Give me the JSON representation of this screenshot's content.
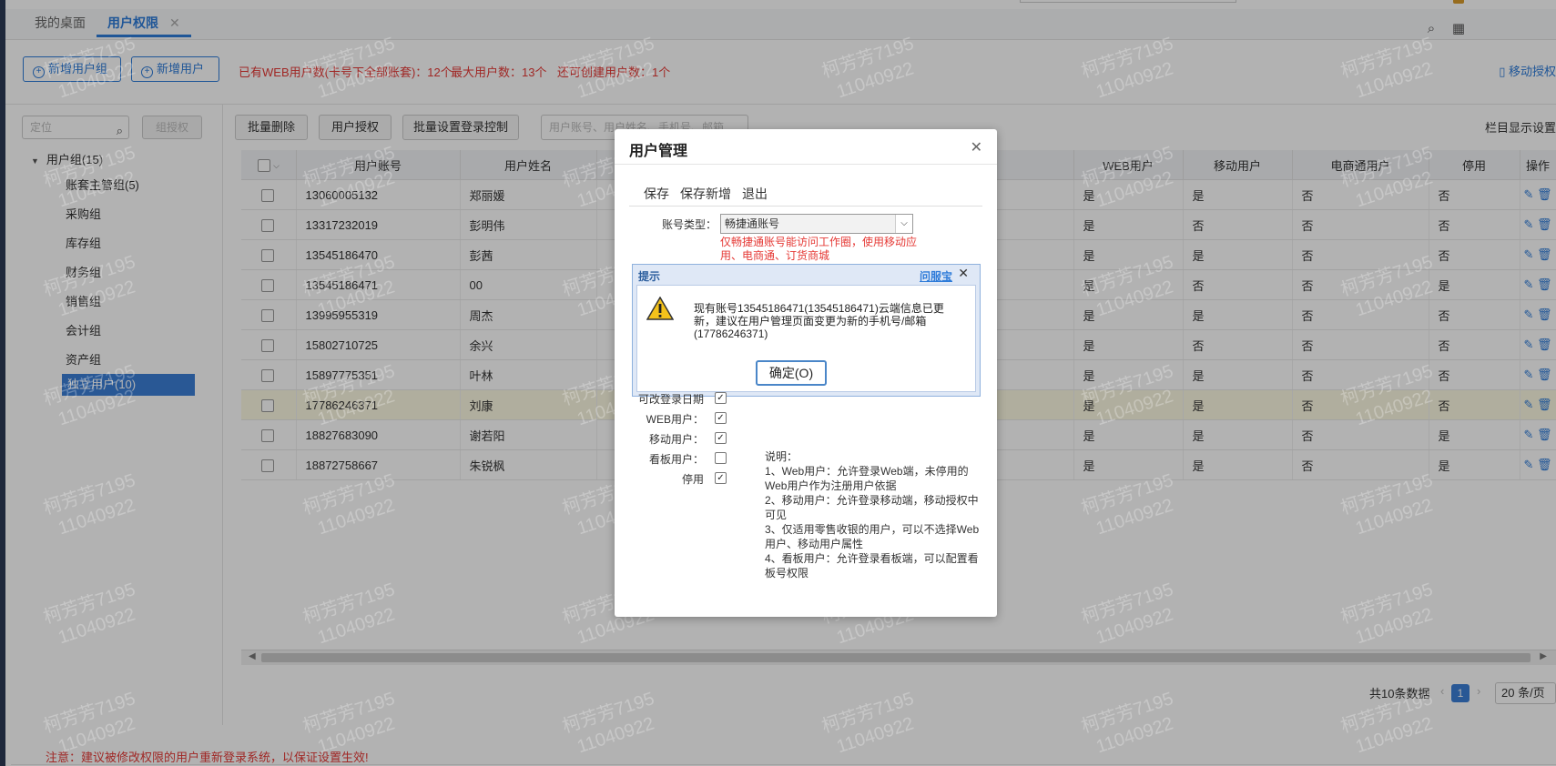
{
  "tabs": [
    {
      "label": "我的桌面"
    },
    {
      "label": "用户权限"
    }
  ],
  "toolbar": {
    "add_group": "新增用户组",
    "add_user": "新增用户",
    "web_user_count": "已有WEB用户数(卡号下全部账套)：12个",
    "max_users": "最大用户数：13个",
    "can_create": "还可创建用户数：1个",
    "mobile_auth": "移动授权"
  },
  "sidebar": {
    "locate_placeholder": "定位",
    "group_auth": "组授权",
    "root": "用户组(15)",
    "items": [
      "账套主管组(5)",
      "采购组",
      "库存组",
      "财务组",
      "销售组",
      "会计组",
      "资产组"
    ],
    "selected": "独立用户(10)"
  },
  "actions": {
    "batch_delete": "批量删除",
    "user_auth": "用户授权",
    "batch_login": "批量设置登录控制",
    "search_placeholder": "用户账号、用户姓名、手机号、邮箱",
    "column_settings": "栏目显示设置"
  },
  "table": {
    "columns": [
      "用户账号",
      "用户姓名",
      "WEB用户",
      "移动用户",
      "电商通用户",
      "停用",
      "操作"
    ],
    "rows": [
      {
        "account": "13060005132",
        "name": "郑丽媛",
        "web": "是",
        "mobile": "是",
        "ecom": "否",
        "disabled": "否"
      },
      {
        "account": "13317232019",
        "name": "彭明伟",
        "web": "是",
        "mobile": "否",
        "ecom": "否",
        "disabled": "否"
      },
      {
        "account": "13545186470",
        "name": "彭茜",
        "web": "是",
        "mobile": "是",
        "ecom": "否",
        "disabled": "否"
      },
      {
        "account": "13545186471",
        "name": "00",
        "web": "是",
        "mobile": "否",
        "ecom": "否",
        "disabled": "是"
      },
      {
        "account": "13995955319",
        "name": "周杰",
        "web": "是",
        "mobile": "是",
        "ecom": "否",
        "disabled": "否"
      },
      {
        "account": "15802710725",
        "name": "余兴",
        "web": "是",
        "mobile": "否",
        "ecom": "否",
        "disabled": "否"
      },
      {
        "account": "15897775351",
        "name": "叶林",
        "web": "是",
        "mobile": "是",
        "ecom": "否",
        "disabled": "否"
      },
      {
        "account": "17786246371",
        "name": "刘康",
        "web": "是",
        "mobile": "是",
        "ecom": "否",
        "disabled": "否"
      },
      {
        "account": "18827683090",
        "name": "谢若阳",
        "web": "是",
        "mobile": "是",
        "ecom": "否",
        "disabled": "是"
      },
      {
        "account": "18872758667",
        "name": "朱锐枫",
        "web": "是",
        "mobile": "是",
        "ecom": "否",
        "disabled": "是"
      }
    ],
    "highlighted_row": 7
  },
  "pager": {
    "total": "共10条数据",
    "page": "1",
    "page_size": "20 条/页"
  },
  "footer_note": "注意：建议被修改权限的用户重新登录系统，以保证设置生效!",
  "watermark": {
    "line1": "柯芳芳7195",
    "line2": "11040922"
  },
  "modal": {
    "title": "用户管理",
    "save": "保存",
    "save_new": "保存新增",
    "exit": "退出",
    "account_type_label": "账号类型：",
    "account_type_value": "畅捷通账号",
    "account_hint": "仅畅捷通账号能访问工作圈，使用移动应用、电商通、订货商城",
    "prompt": {
      "title": "提示",
      "link": "问服宝",
      "message": "现有账号13545186471(13545186471)云端信息已更新，建议在用户管理页面变更为新的手机号/邮箱(17786246371)",
      "ok": "确定(O)"
    },
    "checks": [
      {
        "label": "可改登录日期",
        "checked": true
      },
      {
        "label": "WEB用户：",
        "checked": true
      },
      {
        "label": "移动用户：",
        "checked": true
      },
      {
        "label": "看板用户：",
        "checked": false
      },
      {
        "label": "停用",
        "checked": true
      }
    ],
    "description": [
      "说明：",
      "1、Web用户：允许登录Web端，未停用的Web用户作为注册用户依据",
      "2、移动用户：允许登录移动端，移动授权中可见",
      "3、仅适用零售收银的用户，可以不选择Web用户、移动用户属性",
      "4、看板用户：允许登录看板端，可以配置看板号权限"
    ]
  },
  "colors": {
    "accent": "#2d7bd9",
    "danger": "#e53935",
    "selected": "#3b7fd6"
  }
}
